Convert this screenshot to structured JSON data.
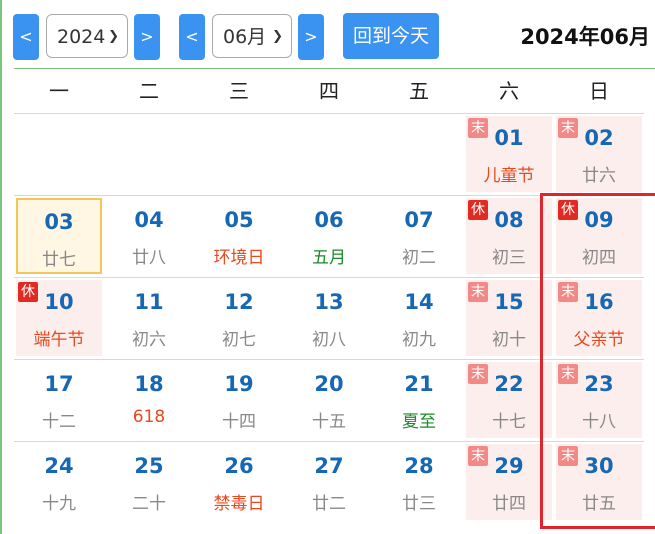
{
  "toolbar": {
    "prev_year": "<",
    "next_year": ">",
    "year_value": "2024",
    "prev_month": "<",
    "next_month": ">",
    "month_value": "06月",
    "today_label": "回到今天",
    "title": "2024年06月"
  },
  "weekdays": [
    "一",
    "二",
    "三",
    "四",
    "五",
    "六",
    "日"
  ],
  "weeks": [
    [
      null,
      null,
      null,
      null,
      null,
      {
        "day": "01",
        "lunar": "儿童节",
        "kind": "holiday",
        "badge": "末",
        "weekend": true
      },
      {
        "day": "02",
        "lunar": "廿六",
        "kind": "normal",
        "badge": "末",
        "weekend": true
      }
    ],
    [
      {
        "day": "03",
        "lunar": "廿七",
        "kind": "normal",
        "today": true
      },
      {
        "day": "04",
        "lunar": "廿八",
        "kind": "normal"
      },
      {
        "day": "05",
        "lunar": "环境日",
        "kind": "holiday"
      },
      {
        "day": "06",
        "lunar": "五月",
        "kind": "term"
      },
      {
        "day": "07",
        "lunar": "初二",
        "kind": "normal"
      },
      {
        "day": "08",
        "lunar": "初三",
        "kind": "normal",
        "badge": "休",
        "badge_kind": "rest",
        "weekend": true
      },
      {
        "day": "09",
        "lunar": "初四",
        "kind": "normal",
        "badge": "休",
        "badge_kind": "rest",
        "weekend": true
      }
    ],
    [
      {
        "day": "10",
        "lunar": "端午节",
        "kind": "holiday",
        "badge": "休",
        "badge_kind": "rest",
        "weekend": true
      },
      {
        "day": "11",
        "lunar": "初六",
        "kind": "normal"
      },
      {
        "day": "12",
        "lunar": "初七",
        "kind": "normal"
      },
      {
        "day": "13",
        "lunar": "初八",
        "kind": "normal"
      },
      {
        "day": "14",
        "lunar": "初九",
        "kind": "normal"
      },
      {
        "day": "15",
        "lunar": "初十",
        "kind": "normal",
        "badge": "末",
        "weekend": true
      },
      {
        "day": "16",
        "lunar": "父亲节",
        "kind": "holiday",
        "badge": "末",
        "weekend": true
      }
    ],
    [
      {
        "day": "17",
        "lunar": "十二",
        "kind": "normal"
      },
      {
        "day": "18",
        "lunar": "618",
        "kind": "holiday"
      },
      {
        "day": "19",
        "lunar": "十四",
        "kind": "normal"
      },
      {
        "day": "20",
        "lunar": "十五",
        "kind": "normal"
      },
      {
        "day": "21",
        "lunar": "夏至",
        "kind": "term"
      },
      {
        "day": "22",
        "lunar": "十七",
        "kind": "normal",
        "badge": "末",
        "weekend": true
      },
      {
        "day": "23",
        "lunar": "十八",
        "kind": "normal",
        "badge": "末",
        "weekend": true
      }
    ],
    [
      {
        "day": "24",
        "lunar": "十九",
        "kind": "normal"
      },
      {
        "day": "25",
        "lunar": "二十",
        "kind": "normal"
      },
      {
        "day": "26",
        "lunar": "禁毒日",
        "kind": "holiday"
      },
      {
        "day": "27",
        "lunar": "廿二",
        "kind": "normal"
      },
      {
        "day": "28",
        "lunar": "廿三",
        "kind": "normal"
      },
      {
        "day": "29",
        "lunar": "廿四",
        "kind": "normal",
        "badge": "末",
        "weekend": true
      },
      {
        "day": "30",
        "lunar": "廿五",
        "kind": "normal",
        "badge": "末",
        "weekend": true
      }
    ]
  ],
  "colors": {
    "button_blue": "#3a93f0",
    "day_number": "#1667b4",
    "holiday_text": "#e8491d",
    "solar_term_text": "#1a8a2a",
    "weekend_bg": "#fdeeee",
    "today_border": "#f1c65a",
    "selection_border": "#e0262c"
  }
}
